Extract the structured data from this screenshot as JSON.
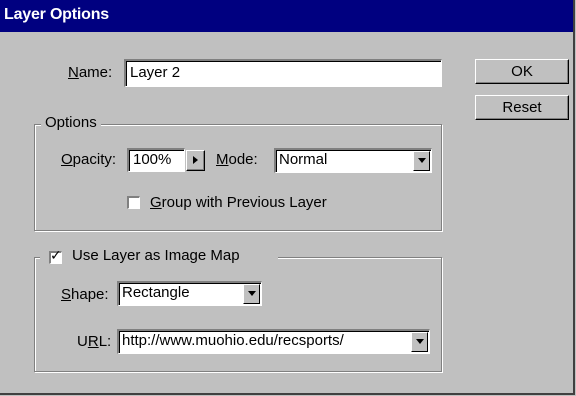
{
  "window": {
    "title": "Layer Options"
  },
  "name_field": {
    "label_first": "N",
    "label_rest": "ame:",
    "value": "Layer 2"
  },
  "buttons": {
    "ok": "OK",
    "reset": "Reset"
  },
  "options_group": {
    "legend": "Options",
    "opacity": {
      "label_first": "O",
      "label_rest": "pacity:",
      "value": "100%"
    },
    "mode": {
      "label_first": "M",
      "label_rest": "ode:",
      "value": "Normal"
    },
    "group_previous": {
      "label_first": "G",
      "label_rest": "roup with Previous Layer",
      "checked": false
    }
  },
  "image_map_group": {
    "legend": "Use Layer as Image Map",
    "checked": true,
    "shape": {
      "label_first": "S",
      "label_rest": "hape:",
      "value": "Rectangle"
    },
    "url": {
      "label_pre": "U",
      "label_u": "R",
      "label_rest": "L:",
      "value": "http://www.muohio.edu/recsports/"
    }
  }
}
